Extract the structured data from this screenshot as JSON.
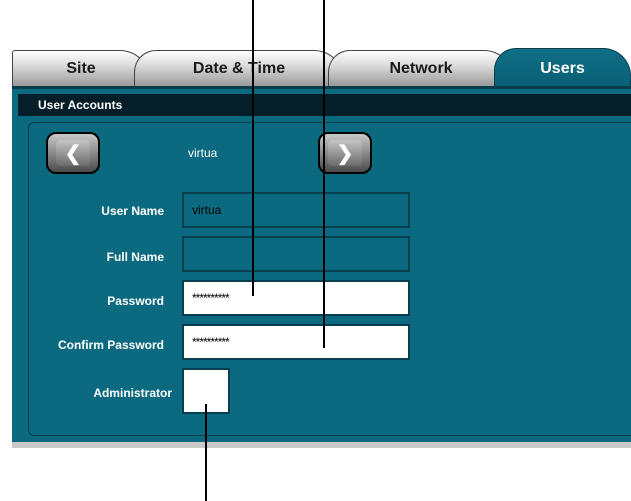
{
  "tabs": {
    "site": "Site",
    "date_time": "Date & Time",
    "network": "Network",
    "users": "Users"
  },
  "section": {
    "title": "User Accounts"
  },
  "navigator": {
    "current_user": "virtua",
    "prev_icon": "chevron-left-icon",
    "next_icon": "chevron-right-icon"
  },
  "form": {
    "user_name_label": "User Name",
    "user_name_value": "virtua",
    "full_name_label": "Full Name",
    "full_name_value": "",
    "password_label": "Password",
    "password_value": "**********",
    "confirm_password_label": "Confirm Password",
    "confirm_password_value": "**********",
    "administrator_label": "Administrator",
    "administrator_checked": false
  },
  "colors": {
    "panel": "#0c6a80",
    "section_bar": "#061e2a",
    "active_tab": "#0e6f86"
  }
}
